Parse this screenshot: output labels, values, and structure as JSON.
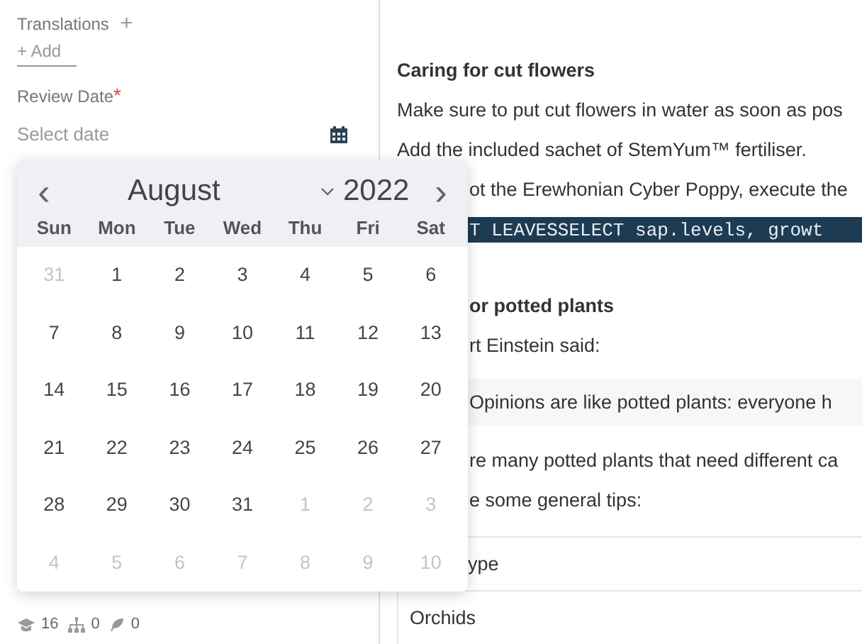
{
  "sidebar": {
    "translations": {
      "label": "Translations",
      "add_icon": "+"
    },
    "add_button": {
      "icon": "+",
      "label": "Add"
    },
    "review_date": {
      "label": "Review Date",
      "required": "*",
      "placeholder": "Select date"
    },
    "stats": [
      {
        "kind": "graduate",
        "value": "16"
      },
      {
        "kind": "hierarchy",
        "value": "0"
      },
      {
        "kind": "feather",
        "value": "0"
      }
    ]
  },
  "datepicker": {
    "prev": "‹",
    "next": "›",
    "month": "August",
    "year": "2022",
    "weekdays": [
      "Sun",
      "Mon",
      "Tue",
      "Wed",
      "Thu",
      "Fri",
      "Sat"
    ],
    "weeks": [
      [
        {
          "day": "31",
          "outside": true
        },
        {
          "day": "1",
          "outside": false
        },
        {
          "day": "2",
          "outside": false
        },
        {
          "day": "3",
          "outside": false
        },
        {
          "day": "4",
          "outside": false
        },
        {
          "day": "5",
          "outside": false
        },
        {
          "day": "6",
          "outside": false
        }
      ],
      [
        {
          "day": "7",
          "outside": false
        },
        {
          "day": "8",
          "outside": false
        },
        {
          "day": "9",
          "outside": false
        },
        {
          "day": "10",
          "outside": false
        },
        {
          "day": "11",
          "outside": false
        },
        {
          "day": "12",
          "outside": false
        },
        {
          "day": "13",
          "outside": false
        }
      ],
      [
        {
          "day": "14",
          "outside": false
        },
        {
          "day": "15",
          "outside": false
        },
        {
          "day": "16",
          "outside": false
        },
        {
          "day": "17",
          "outside": false
        },
        {
          "day": "18",
          "outside": false
        },
        {
          "day": "19",
          "outside": false
        },
        {
          "day": "20",
          "outside": false
        }
      ],
      [
        {
          "day": "21",
          "outside": false
        },
        {
          "day": "22",
          "outside": false
        },
        {
          "day": "23",
          "outside": false
        },
        {
          "day": "24",
          "outside": false
        },
        {
          "day": "25",
          "outside": false
        },
        {
          "day": "26",
          "outside": false
        },
        {
          "day": "27",
          "outside": false
        }
      ],
      [
        {
          "day": "28",
          "outside": false
        },
        {
          "day": "29",
          "outside": false
        },
        {
          "day": "30",
          "outside": false
        },
        {
          "day": "31",
          "outside": false
        },
        {
          "day": "1",
          "outside": true
        },
        {
          "day": "2",
          "outside": true
        },
        {
          "day": "3",
          "outside": true
        }
      ],
      [
        {
          "day": "4",
          "outside": true
        },
        {
          "day": "5",
          "outside": true
        },
        {
          "day": "6",
          "outside": true
        },
        {
          "day": "7",
          "outside": true
        },
        {
          "day": "8",
          "outside": true
        },
        {
          "day": "9",
          "outside": true
        },
        {
          "day": "10",
          "outside": true
        }
      ]
    ]
  },
  "content": [
    {
      "kind": "heading",
      "text": "Caring for cut flowers",
      "hidden_start": false
    },
    {
      "kind": "paragraph",
      "text": "Make sure to put cut flowers in water as soon as pos",
      "hidden_start": false
    },
    {
      "kind": "paragraph",
      "text": "Add the included sachet of StemYum™ fertiliser.",
      "hidden_start": false
    },
    {
      "kind": "paragraph",
      "text": "ot the Erewhonian Cyber Poppy, execute the",
      "hidden_start": true
    },
    {
      "kind": "code",
      "text": "T LEAVESSELECT sap.levels, growt",
      "hidden_start": true
    },
    {
      "kind": "heading",
      "text": "or potted plants",
      "hidden_start": true
    },
    {
      "kind": "paragraph",
      "text": "rt Einstein said:",
      "hidden_start": true
    },
    {
      "kind": "quote",
      "text": "Opinions are like potted plants: everyone h"
    },
    {
      "kind": "paragraph",
      "text": "re many potted plants that need different ca",
      "hidden_start": true
    },
    {
      "kind": "paragraph",
      "text": "e some general tips:",
      "hidden_start": true
    }
  ],
  "table": {
    "rows": [
      {
        "text": "ype",
        "hidden_start": true
      },
      {
        "text": "Orchids",
        "hidden_start": false
      }
    ]
  }
}
